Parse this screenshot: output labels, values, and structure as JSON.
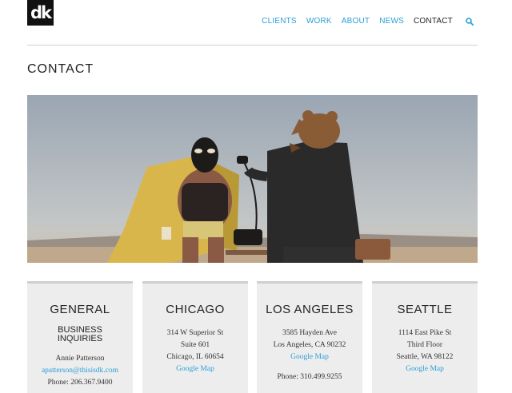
{
  "header": {
    "logo_text": "dk",
    "nav": [
      "CLIENTS",
      "WORK",
      "ABOUT",
      "NEWS",
      "CONTACT"
    ],
    "active": "CONTACT",
    "search_icon": "search-icon",
    "accent": "#2a9fd6"
  },
  "page": {
    "title": "CONTACT"
  },
  "hero": {
    "description_icon": "photo"
  },
  "offices": [
    {
      "title": "GENERAL",
      "subtitle_1": "BUSINESS",
      "subtitle_2": "INQUIRIES",
      "name": "Annie Patterson",
      "email": "apatterson@thisisdk.com",
      "phone": "Phone: 206.367.9400"
    },
    {
      "title": "CHICAGO",
      "address_1": "314 W Superior St",
      "address_2": "Suite 601",
      "city": "Chicago, IL 60654",
      "map": "Google Map"
    },
    {
      "title": "LOS ANGELES",
      "address_1": "3585 Hayden Ave",
      "city": "Los Angeles, CA 90232",
      "map": "Google Map",
      "phone": "Phone: 310.499.9255"
    },
    {
      "title": "SEATTLE",
      "address_1": "1114 East Pike St",
      "address_2": "Third Floor",
      "city": "Seattle, WA 98122",
      "map": "Google Map"
    }
  ]
}
